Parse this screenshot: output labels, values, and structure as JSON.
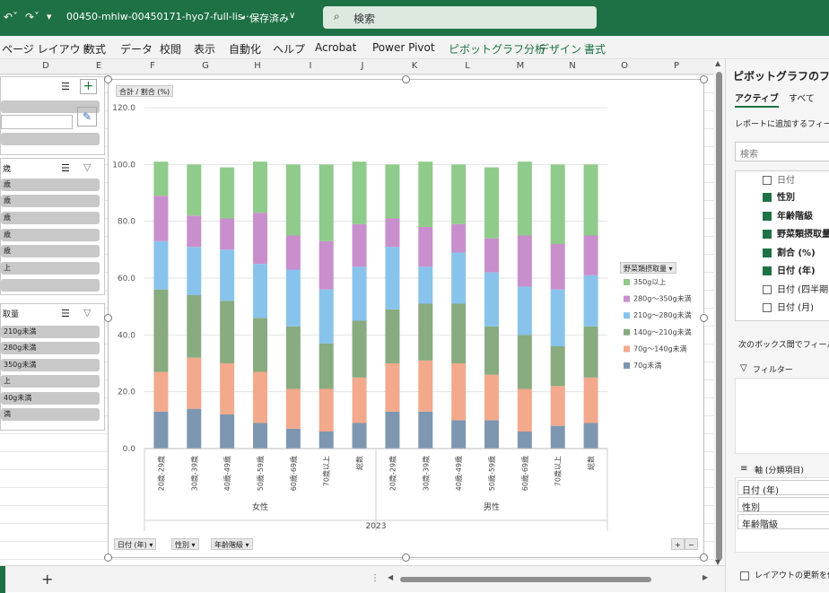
{
  "titlebar": {
    "filename": "00450-mhlw-00450171-hyo7-full-lis···",
    "save_status": "• 保存済み",
    "search_placeholder": "検索"
  },
  "ribbon_tabs": [
    "ページ レイアウト",
    "数式",
    "データ",
    "校閲",
    "表示",
    "自動化",
    "ヘルプ",
    "Acrobat",
    "Power Pivot",
    "ピボットグラフ分析",
    "デザイン",
    "書式"
  ],
  "columns": [
    "D",
    "E",
    "F",
    "G",
    "H",
    "I",
    "J",
    "K",
    "L",
    "M",
    "N",
    "O",
    "P"
  ],
  "slicer_age": {
    "title": "歳",
    "items": [
      "歳",
      "歳",
      "歳",
      "歳",
      "歳",
      "上",
      ""
    ]
  },
  "slicer_veg": {
    "title": "取量",
    "items": [
      "210g未満",
      "280g未満",
      "350g未満",
      "上",
      "40g未満",
      "満"
    ]
  },
  "chart_data": {
    "type": "bar",
    "stacked": true,
    "value_label": "合計 / 割合 (%)",
    "ylim": [
      0,
      120
    ],
    "yticks": [
      "0.0",
      "20.0",
      "40.0",
      "60.0",
      "80.0",
      "100.0",
      "120.0"
    ],
    "categories": [
      "20歳-29歳",
      "30歳-39歳",
      "40歳-49歳",
      "50歳-59歳",
      "60歳-69歳",
      "70歳以上",
      "総数",
      "20歳-29歳",
      "30歳-39歳",
      "40歳-49歳",
      "50歳-59歳",
      "60歳-69歳",
      "70歳以上",
      "総数"
    ],
    "groups": [
      "女性",
      "男性"
    ],
    "year": "2023",
    "legend_title": "野菜類摂取量",
    "legend_position": "right",
    "series": [
      {
        "name": "70g未満",
        "color": "#7e97b0",
        "values": [
          13,
          14,
          12,
          9,
          7,
          6,
          9,
          13,
          13,
          10,
          10,
          6,
          8,
          9
        ]
      },
      {
        "name": "70g〜140g未満",
        "color": "#f2a98c",
        "values": [
          14,
          18,
          18,
          18,
          14,
          15,
          16,
          17,
          18,
          20,
          16,
          15,
          14,
          16
        ]
      },
      {
        "name": "140g〜210g未満",
        "color": "#88ab80",
        "values": [
          29,
          22,
          22,
          19,
          22,
          16,
          20,
          19,
          20,
          21,
          17,
          19,
          14,
          18
        ]
      },
      {
        "name": "210g〜280g未満",
        "color": "#88c3ec",
        "values": [
          17,
          17,
          18,
          19,
          20,
          19,
          19,
          22,
          13,
          18,
          19,
          17,
          20,
          18
        ]
      },
      {
        "name": "280g〜350g未満",
        "color": "#c98fcc",
        "values": [
          16,
          11,
          11,
          18,
          12,
          17,
          15,
          10,
          14,
          10,
          12,
          18,
          16,
          14
        ]
      },
      {
        "name": "350g以上",
        "color": "#8fcb8a",
        "values": [
          12,
          18,
          18,
          18,
          25,
          27,
          22,
          19,
          23,
          21,
          25,
          26,
          28,
          25
        ]
      }
    ]
  },
  "chart_filters": [
    "日付 (年)",
    "性別",
    "年齢階級"
  ],
  "pivot_pane": {
    "title": "ピボットグラフのフィール",
    "tab_active": "アクティブ",
    "tab_all": "すべて",
    "instruction": "レポートに追加するフィール",
    "search_placeholder": "検索",
    "fields": [
      {
        "label": "日付",
        "checked": false
      },
      {
        "label": "性別",
        "checked": true
      },
      {
        "label": "年齢階級",
        "checked": true
      },
      {
        "label": "野菜類摂取量",
        "checked": true
      },
      {
        "label": "割合 (%)",
        "checked": true
      },
      {
        "label": "日付 (年)",
        "checked": true
      },
      {
        "label": "日付 (四半期)",
        "checked": false
      },
      {
        "label": "日付 (月)",
        "checked": false
      }
    ],
    "drag_hint": "次のボックス間でフィールドを",
    "filter_label": "フィルター",
    "axis_label": "軸 (分類項目)",
    "axis_items": [
      "日付 (年)",
      "性別",
      "年齢階級"
    ],
    "defer_label": "レイアウトの更新を保"
  },
  "colors": {
    "accent": "#1e7145",
    "header_bg": "#1e7145"
  }
}
